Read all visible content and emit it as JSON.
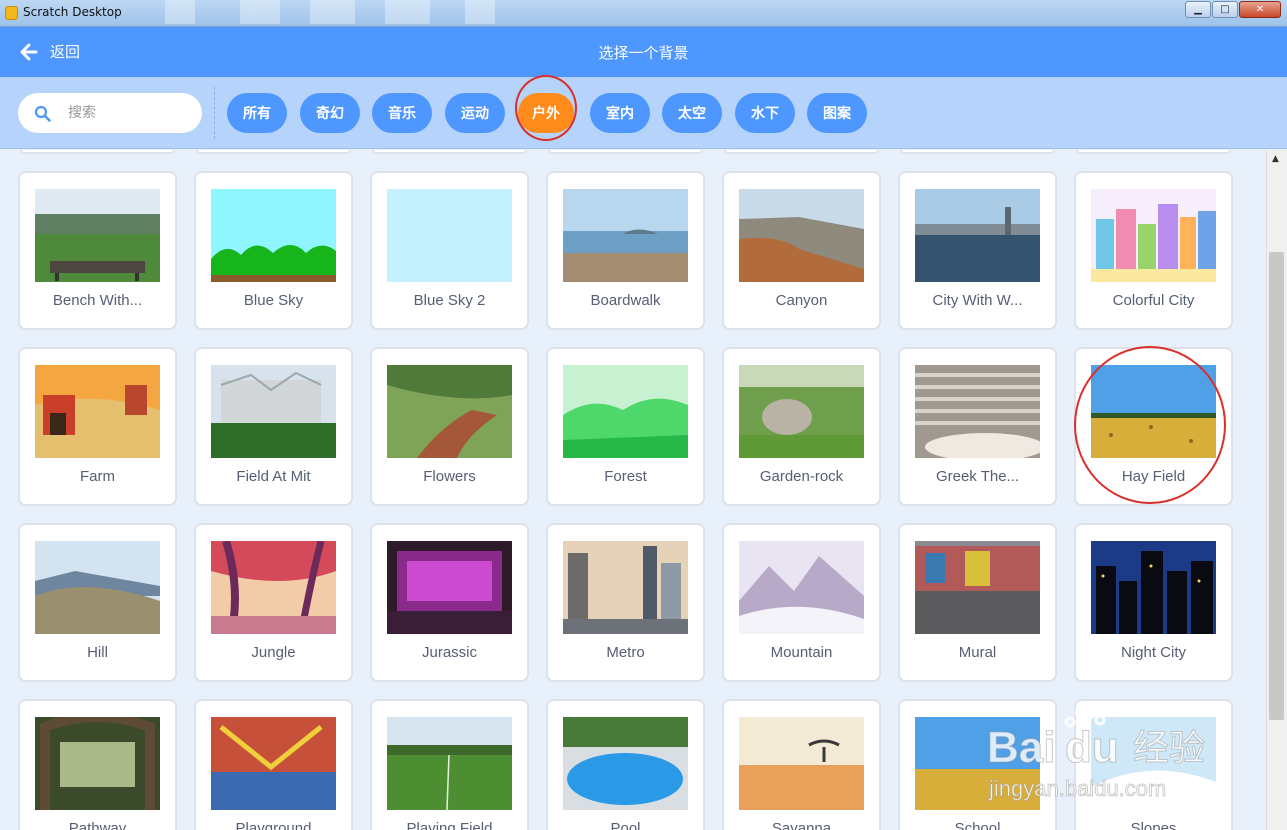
{
  "window": {
    "title": "Scratch Desktop",
    "minimize": "▁",
    "maximize": "□",
    "close": "✕"
  },
  "header": {
    "back_label": "返回",
    "title": "选择一个背景"
  },
  "search": {
    "placeholder": "搜索",
    "value": ""
  },
  "tags": [
    {
      "label": "所有",
      "active": false
    },
    {
      "label": "奇幻",
      "active": false
    },
    {
      "label": "音乐",
      "active": false
    },
    {
      "label": "运动",
      "active": false
    },
    {
      "label": "户外",
      "active": true
    },
    {
      "label": "室内",
      "active": false
    },
    {
      "label": "太空",
      "active": false
    },
    {
      "label": "水下",
      "active": false
    },
    {
      "label": "图案",
      "active": false
    }
  ],
  "backdrops": [
    {
      "name": "Bench With...",
      "thumb": "bench"
    },
    {
      "name": "Blue Sky",
      "thumb": "bluesky"
    },
    {
      "name": "Blue Sky 2",
      "thumb": "bluesky2"
    },
    {
      "name": "Boardwalk",
      "thumb": "boardwalk"
    },
    {
      "name": "Canyon",
      "thumb": "canyon"
    },
    {
      "name": "City With W...",
      "thumb": "citywater"
    },
    {
      "name": "Colorful City",
      "thumb": "colorfulcity"
    },
    {
      "name": "Farm",
      "thumb": "farm"
    },
    {
      "name": "Field At Mit",
      "thumb": "fieldmit"
    },
    {
      "name": "Flowers",
      "thumb": "flowers"
    },
    {
      "name": "Forest",
      "thumb": "forest"
    },
    {
      "name": "Garden-rock",
      "thumb": "gardenrock"
    },
    {
      "name": "Greek The...",
      "thumb": "greek"
    },
    {
      "name": "Hay Field",
      "thumb": "hayfield"
    },
    {
      "name": "Hill",
      "thumb": "hill"
    },
    {
      "name": "Jungle",
      "thumb": "jungle"
    },
    {
      "name": "Jurassic",
      "thumb": "jurassic"
    },
    {
      "name": "Metro",
      "thumb": "metro"
    },
    {
      "name": "Mountain",
      "thumb": "mountain"
    },
    {
      "name": "Mural",
      "thumb": "mural"
    },
    {
      "name": "Night City",
      "thumb": "nightcity"
    },
    {
      "name": "Pathway",
      "thumb": "pathway"
    },
    {
      "name": "Playground",
      "thumb": "playground"
    },
    {
      "name": "Playing Field",
      "thumb": "playingfield"
    },
    {
      "name": "Pool",
      "thumb": "pool"
    },
    {
      "name": "Savanna",
      "thumb": "savanna"
    },
    {
      "name": "School",
      "thumb": "school"
    },
    {
      "name": "Slopes",
      "thumb": "slopes"
    }
  ],
  "watermark": {
    "brand": "Bai",
    "brand2": "du",
    "cn": "经验",
    "url": "jingyan.baidu.com"
  },
  "colors": {
    "primary": "#4d97ff",
    "active_tag": "#ff8c1a",
    "filter_bg": "#b6d3fb",
    "annotation": "#d9302c"
  }
}
